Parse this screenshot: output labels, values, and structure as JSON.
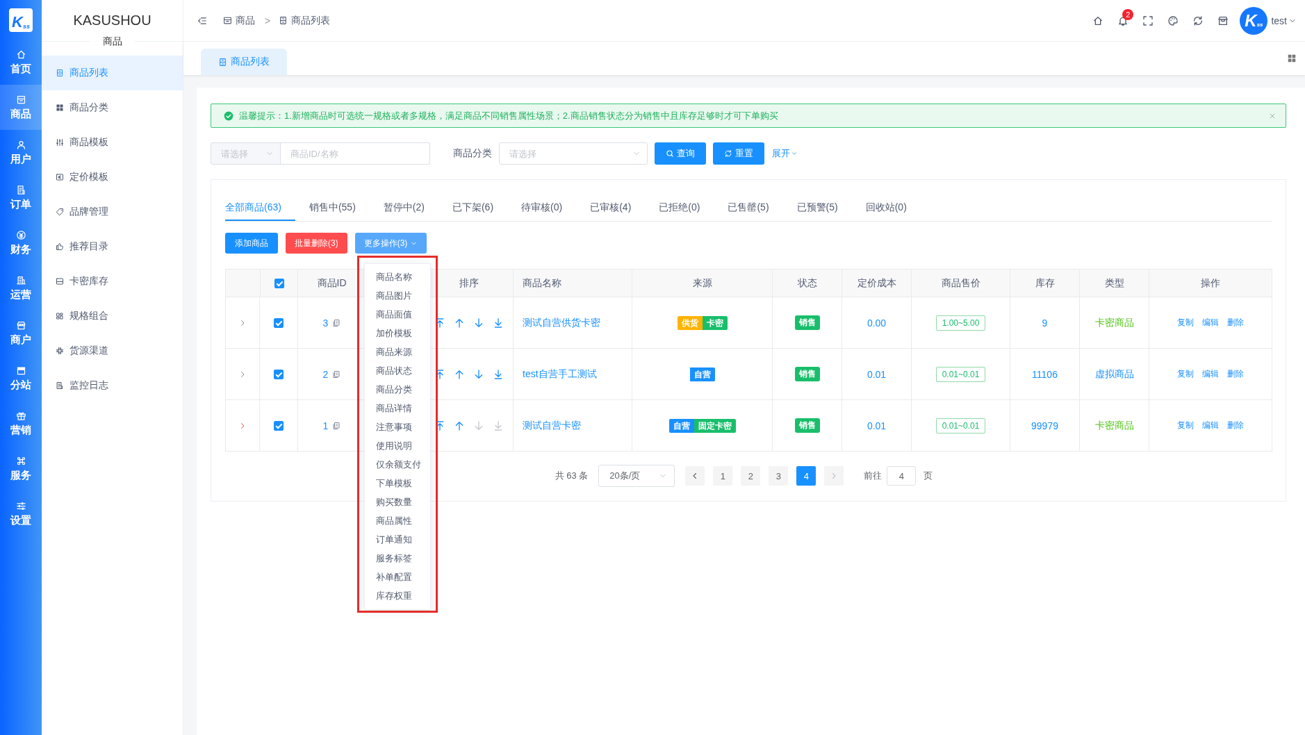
{
  "rail": {
    "logo": {
      "text": "K",
      "sub": "ss"
    },
    "items": [
      {
        "label": "首页",
        "selected": false
      },
      {
        "label": "商品",
        "selected": true
      },
      {
        "label": "用户",
        "selected": false
      },
      {
        "label": "订单",
        "selected": false
      },
      {
        "label": "财务",
        "selected": false
      },
      {
        "label": "运营",
        "selected": false
      },
      {
        "label": "商户",
        "selected": false
      },
      {
        "label": "分站",
        "selected": false
      },
      {
        "label": "营销",
        "selected": false
      },
      {
        "label": "服务",
        "selected": false
      },
      {
        "label": "设置",
        "selected": false
      }
    ]
  },
  "sidebar": {
    "brand": "KASUSHOU",
    "section": "商品",
    "items": [
      {
        "label": "商品列表",
        "selected": true
      },
      {
        "label": "商品分类",
        "selected": false
      },
      {
        "label": "商品模板",
        "selected": false
      },
      {
        "label": "定价模板",
        "selected": false
      },
      {
        "label": "品牌管理",
        "selected": false
      },
      {
        "label": "推荐目录",
        "selected": false
      },
      {
        "label": "卡密库存",
        "selected": false
      },
      {
        "label": "规格组合",
        "selected": false
      },
      {
        "label": "货源渠道",
        "selected": false
      },
      {
        "label": "监控日志",
        "selected": false
      }
    ]
  },
  "header": {
    "breadcrumb": {
      "items": [
        "商品",
        "商品列表"
      ],
      "separator": ">"
    },
    "notification_count": "2",
    "user": {
      "avatar": {
        "text": "K",
        "sub": "ss"
      },
      "name": "test"
    }
  },
  "page_tabs": [
    {
      "label": "商品列表",
      "selected": true
    }
  ],
  "alert": {
    "text": "温馨提示：1.新增商品时可选统一规格或者多规格，满足商品不同销售属性场景；2.商品销售状态分为销售中且库存足够时才可下单购买"
  },
  "filters": {
    "type_select": {
      "placeholder": "请选择"
    },
    "keyword": {
      "placeholder": "商品ID/名称"
    },
    "category": {
      "label": "商品分类",
      "placeholder": "请选择"
    },
    "buttons": [
      "查询",
      "重置"
    ],
    "expand": "展开"
  },
  "status_tabs": [
    {
      "label": "全部商品(63)",
      "selected": true
    },
    {
      "label": "销售中(55)",
      "selected": false
    },
    {
      "label": "暂停中(2)",
      "selected": false
    },
    {
      "label": "已下架(6)",
      "selected": false
    },
    {
      "label": "待审核(0)",
      "selected": false
    },
    {
      "label": "已审核(4)",
      "selected": false
    },
    {
      "label": "已拒绝(0)",
      "selected": false
    },
    {
      "label": "已售罄(5)",
      "selected": false
    },
    {
      "label": "已预警(5)",
      "selected": false
    },
    {
      "label": "回收站(0)",
      "selected": false
    }
  ],
  "actions": [
    {
      "label": "添加商品",
      "kind": "primary"
    },
    {
      "label": "批量删除(3)",
      "kind": "danger"
    },
    {
      "label": "更多操作(3)",
      "kind": "dropdown"
    }
  ],
  "more_menu": {
    "open": true,
    "highlighted": true,
    "items": [
      "商品名称",
      "商品图片",
      "商品面值",
      "加价模板",
      "商品来源",
      "商品状态",
      "商品分类",
      "商品详情",
      "注意事项",
      "使用说明",
      "仅余额支付",
      "下单模板",
      "购买数量",
      "商品属性",
      "订单通知",
      "服务标签",
      "补单配置",
      "库存权重"
    ]
  },
  "table": {
    "all_checked": true,
    "columns": [
      "商品ID",
      "排序",
      "商品名称",
      "来源",
      "状态",
      "定价成本",
      "商品售价",
      "库存",
      "类型",
      "操作"
    ],
    "rows": [
      {
        "expanded": false,
        "expand_highlighted": false,
        "checked": true,
        "id": "3",
        "move_down_disabled": false,
        "name": "测试自营供货卡密",
        "sources": [
          {
            "label": "供货",
            "color": "#ffb300"
          },
          {
            "label": "卡密",
            "color": "#19be6b"
          }
        ],
        "status": "销售",
        "cost": "0.00",
        "price": "1.00~5.00",
        "stock": "9",
        "type": {
          "label": "卡密商品",
          "color": "#52c41a"
        },
        "actions": [
          "复制",
          "编辑",
          "删除"
        ]
      },
      {
        "expanded": false,
        "expand_highlighted": false,
        "checked": true,
        "id": "2",
        "move_down_disabled": false,
        "name": "test自营手工测试",
        "sources": [
          {
            "label": "自营",
            "color": "#1890ff"
          }
        ],
        "status": "销售",
        "cost": "0.01",
        "price": "0.01~0.01",
        "stock": "11106",
        "type": {
          "label": "虚拟商品",
          "color": "#1890ff"
        },
        "actions": [
          "复制",
          "编辑",
          "删除"
        ]
      },
      {
        "expanded": false,
        "expand_highlighted": true,
        "checked": true,
        "id": "1",
        "move_down_disabled": true,
        "name": "测试自营卡密",
        "sources": [
          {
            "label": "自营",
            "color": "#1890ff"
          },
          {
            "label": "固定卡密",
            "color": "#19be6b"
          }
        ],
        "status": "销售",
        "cost": "0.01",
        "price": "0.01~0.01",
        "stock": "99979",
        "type": {
          "label": "卡密商品",
          "color": "#52c41a"
        },
        "actions": [
          "复制",
          "编辑",
          "删除"
        ]
      }
    ]
  },
  "pagination": {
    "total": "共 63 条",
    "page_size": "20条/页",
    "prev_disabled": false,
    "next_disabled": true,
    "pages": [
      {
        "label": "1",
        "selected": false
      },
      {
        "label": "2",
        "selected": false
      },
      {
        "label": "3",
        "selected": false
      },
      {
        "label": "4",
        "selected": true
      }
    ],
    "jump_label": "前往",
    "jump_value": "4",
    "jump_suffix": "页"
  }
}
